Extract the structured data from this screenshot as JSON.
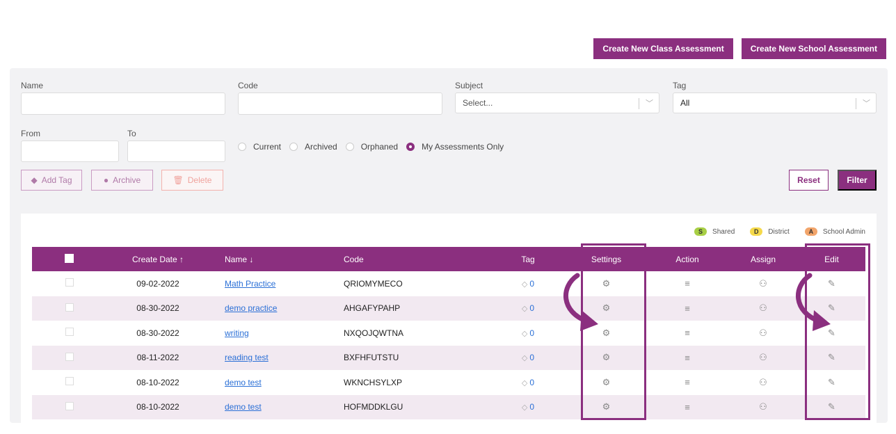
{
  "header": {
    "create_class_label": "Create New Class Assessment",
    "create_school_label": "Create New School Assessment"
  },
  "filters": {
    "name_label": "Name",
    "code_label": "Code",
    "subject_label": "Subject",
    "subject_placeholder": "Select...",
    "tag_label": "Tag",
    "tag_value": "All",
    "from_label": "From",
    "to_label": "To",
    "radios": [
      {
        "label": "Current",
        "selected": false
      },
      {
        "label": "Archived",
        "selected": false
      },
      {
        "label": "Orphaned",
        "selected": false
      },
      {
        "label": "My Assessments Only",
        "selected": true
      }
    ],
    "add_tag_label": "Add Tag",
    "archive_label": "Archive",
    "delete_label": "Delete",
    "reset_label": "Reset",
    "filter_label": "Filter"
  },
  "legend": [
    {
      "letter": "S",
      "label": "Shared",
      "color": "#a8cf45"
    },
    {
      "letter": "D",
      "label": "District",
      "color": "#f5d94a"
    },
    {
      "letter": "A",
      "label": "School Admin",
      "color": "#f2a56b"
    }
  ],
  "table": {
    "columns": {
      "create_date": "Create Date ↑",
      "name": "Name ↓",
      "code": "Code",
      "tag": "Tag",
      "settings": "Settings",
      "action": "Action",
      "assign": "Assign",
      "edit": "Edit"
    },
    "rows": [
      {
        "date": "09-02-2022",
        "name": "Math Practice",
        "code": "QRIOMYMECO",
        "tag": "0"
      },
      {
        "date": "08-30-2022",
        "name": "demo practice",
        "code": "AHGAFYPAHP",
        "tag": "0"
      },
      {
        "date": "08-30-2022",
        "name": "writing",
        "code": "NXQOJQWTNA",
        "tag": "0"
      },
      {
        "date": "08-11-2022",
        "name": "reading test",
        "code": "BXFHFUTSTU",
        "tag": "0"
      },
      {
        "date": "08-10-2022",
        "name": "demo test",
        "code": "WKNCHSYLXP",
        "tag": "0"
      },
      {
        "date": "08-10-2022",
        "name": "demo test",
        "code": "HOFMDDKLGU",
        "tag": "0"
      }
    ]
  },
  "colors": {
    "brand": "#8b2f7f",
    "row_alt": "#f2e9f1",
    "link": "#2a6fd6"
  }
}
